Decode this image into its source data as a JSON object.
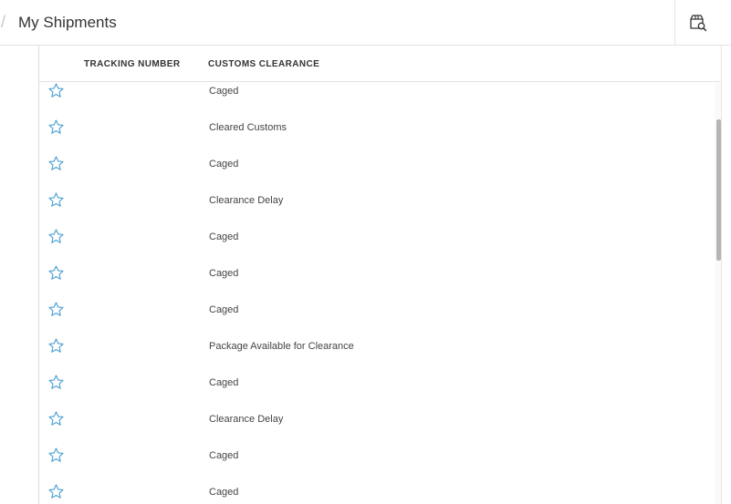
{
  "header": {
    "separator": "/",
    "title": "My Shipments",
    "action_icon": "package-search-icon"
  },
  "table": {
    "columns": [
      "TRACKING NUMBER",
      "CUSTOMS CLEARANCE"
    ],
    "rows": [
      {
        "tracking": "",
        "customs": "Caged"
      },
      {
        "tracking": "",
        "customs": "Cleared Customs"
      },
      {
        "tracking": "",
        "customs": "Caged"
      },
      {
        "tracking": "",
        "customs": "Clearance Delay"
      },
      {
        "tracking": "",
        "customs": "Caged"
      },
      {
        "tracking": "",
        "customs": "Caged"
      },
      {
        "tracking": "",
        "customs": "Caged"
      },
      {
        "tracking": "",
        "customs": "Package Available for Clearance"
      },
      {
        "tracking": "",
        "customs": "Caged"
      },
      {
        "tracking": "",
        "customs": "Clearance Delay"
      },
      {
        "tracking": "",
        "customs": "Caged"
      },
      {
        "tracking": "",
        "customs": "Caged"
      }
    ]
  },
  "colors": {
    "star_outline": "#4a9fd0",
    "border": "#e3e3e3",
    "scroll_thumb": "#b5b5b5"
  },
  "icons": {
    "row_favorite": "star-outline-icon"
  }
}
